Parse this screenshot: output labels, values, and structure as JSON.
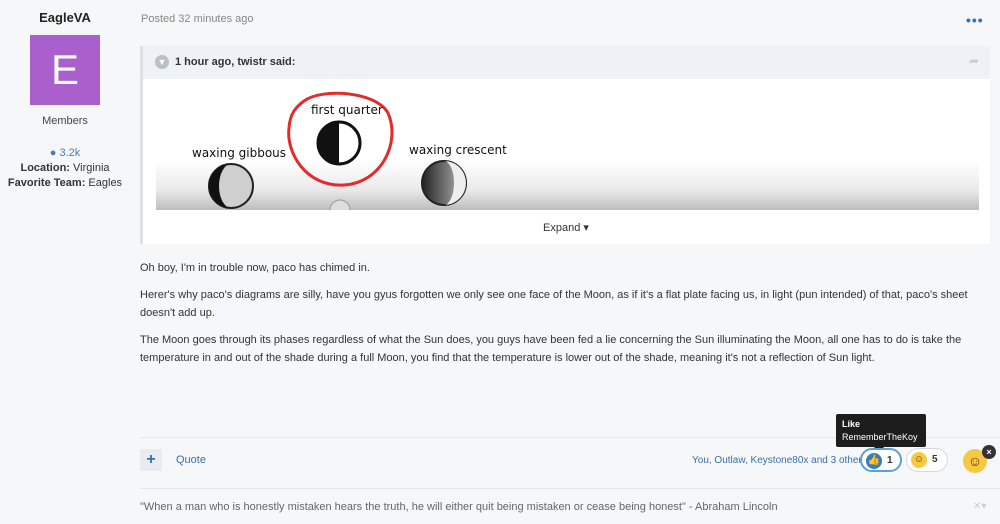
{
  "author": {
    "name": "EagleVA",
    "avatar_letter": "E",
    "avatar_color": "#a95fcc",
    "group": "Members",
    "post_count": "3.2k",
    "location_label": "Location:",
    "location": "Virginia",
    "team_label": "Favorite Team:",
    "team": "Eagles"
  },
  "post": {
    "posted": "Posted 32 minutes ago",
    "more_icon": "more-dots-icon",
    "quote": {
      "citation": "1 hour ago, twistr said:",
      "image_labels": [
        "first quarter",
        "waxing gibbous",
        "waxing crescent"
      ],
      "expand_label": "Expand"
    },
    "paragraphs": [
      "Oh boy, I'm in trouble now, paco has chimed in.",
      "Herer's why paco's diagrams are silly, have you gyus forgotten we only see one face of the Moon, as if it's a flat plate facing us, in light (pun intended) of that, paco's sheet doesn't add up.",
      "The Moon goes through its phases regardless of what the Sun does, you guys have been fed a lie concerning the Sun illuminating the Moon, all one has to do is take the temperature  in and out of the shade during a full Moon, you find that the temperature is lower out of the shade, meaning it's not a reflection of Sun light."
    ]
  },
  "footer": {
    "add_label": "+",
    "quote_label": "Quote",
    "reacted_by": "You, Outlaw, Keystone80x and 3 others",
    "reactions": [
      {
        "name": "like",
        "count": "1",
        "color": "#2f7fc2"
      },
      {
        "name": "haha",
        "count": "5",
        "color": "#f6c843"
      }
    ],
    "tooltip": {
      "title": "Like",
      "user": "RememberTheKoy"
    }
  },
  "signature": "\"When a man who is honestly mistaken hears the truth, he will either quit being mistaken or cease being honest\"  -  Abraham Lincoln"
}
